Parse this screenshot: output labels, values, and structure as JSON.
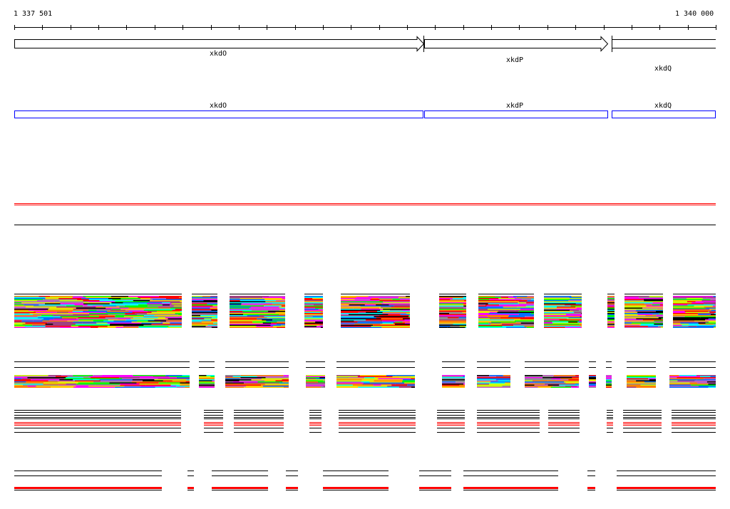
{
  "ruler": {
    "start_label": "1 337 501",
    "end_label": "1 340 000"
  },
  "genes": [
    {
      "name": "xkdO",
      "strand": "+"
    },
    {
      "name": "xkdP",
      "strand": "+"
    },
    {
      "name": "xkdQ",
      "strand": "+"
    }
  ],
  "annotations": [
    {
      "name": "xkdO"
    },
    {
      "name": "xkdP"
    },
    {
      "name": "xkdQ"
    }
  ],
  "colors": {
    "annotation_box": "#0000ff",
    "highlight_line": "#ff0000",
    "palette": [
      "#ff00ff",
      "#00ffff",
      "#ff0000",
      "#0070ff",
      "#00ff00",
      "#ccff00",
      "#ff8000",
      "#909090",
      "#a04080",
      "#000000",
      "#c060c0",
      "#ffcc00"
    ]
  }
}
